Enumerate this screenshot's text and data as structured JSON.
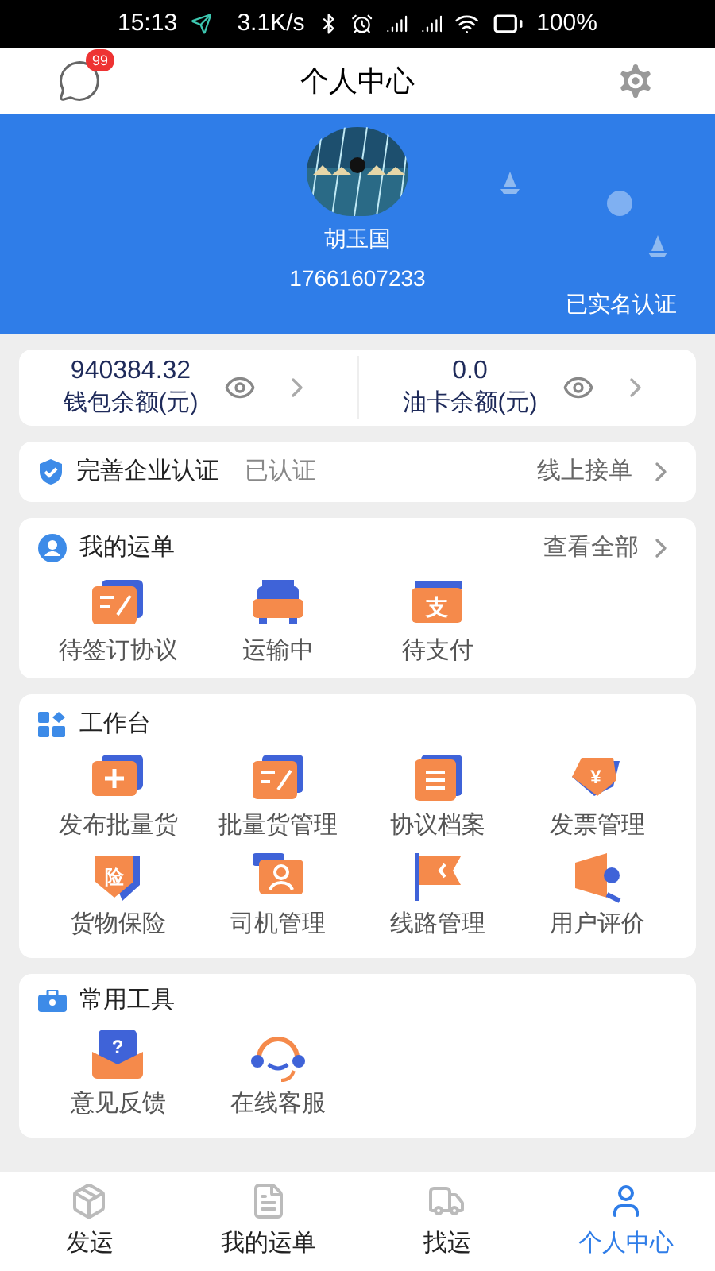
{
  "status_bar": {
    "time": "15:13",
    "speed": "3.1K/s",
    "battery": "100%"
  },
  "header": {
    "title": "个人中心",
    "badge": "99"
  },
  "profile": {
    "name": "胡玉国",
    "phone": "17661607233",
    "verified": "已实名认证"
  },
  "balances": [
    {
      "amount": "940384.32",
      "label": "钱包余额(元)"
    },
    {
      "amount": "0.0",
      "label": "油卡余额(元)"
    }
  ],
  "certification": {
    "title": "完善企业认证",
    "status": "已认证",
    "link": "线上接单"
  },
  "orders": {
    "title": "我的运单",
    "link": "查看全部",
    "items": [
      {
        "label": "待签订协议",
        "kind": "edit"
      },
      {
        "label": "运输中",
        "kind": "truck"
      },
      {
        "label": "待支付",
        "kind": "pay",
        "glyph": "支"
      }
    ]
  },
  "workbench": {
    "title": "工作台",
    "items": [
      {
        "label": "发布批量货",
        "kind": "plus"
      },
      {
        "label": "批量货管理",
        "kind": "edit"
      },
      {
        "label": "协议档案",
        "kind": "doc"
      },
      {
        "label": "发票管理",
        "kind": "tag",
        "glyph": "¥"
      },
      {
        "label": "货物保险",
        "kind": "shield",
        "glyph": "险"
      },
      {
        "label": "司机管理",
        "kind": "person"
      },
      {
        "label": "线路管理",
        "kind": "flag"
      },
      {
        "label": "用户评价",
        "kind": "megaphone"
      }
    ]
  },
  "tools": {
    "title": "常用工具",
    "items": [
      {
        "label": "意见反馈",
        "kind": "mail",
        "glyph": "?"
      },
      {
        "label": "在线客服",
        "kind": "headset"
      }
    ]
  },
  "bottom_nav": [
    {
      "label": "发运",
      "kind": "box",
      "selected": false
    },
    {
      "label": "我的运单",
      "kind": "list",
      "selected": false
    },
    {
      "label": "找运",
      "kind": "truck",
      "selected": false
    },
    {
      "label": "个人中心",
      "kind": "person",
      "selected": true
    }
  ]
}
